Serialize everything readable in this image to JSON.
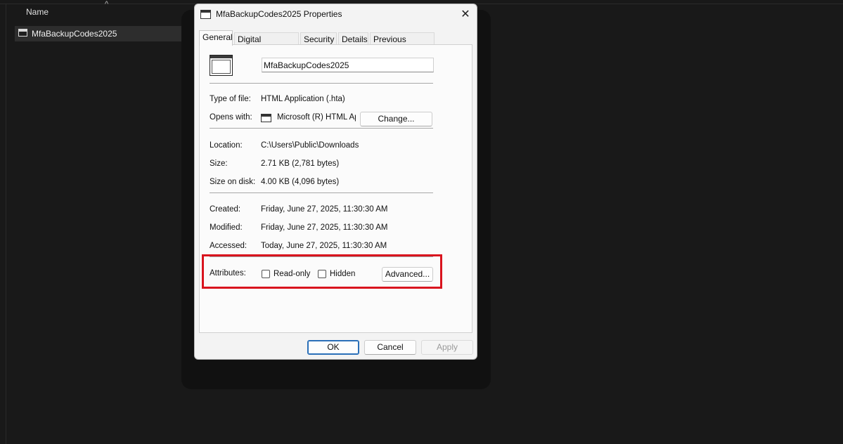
{
  "explorer": {
    "column_header": "Name",
    "sort_indicator": "^",
    "file_name": "MfaBackupCodes2025"
  },
  "dialog": {
    "title": "MfaBackupCodes2025 Properties",
    "close_glyph": "✕",
    "tabs": [
      "General",
      "Digital Signatures",
      "Security",
      "Details",
      "Previous Versions"
    ],
    "name_value": "MfaBackupCodes2025",
    "type_label": "Type of file:",
    "type_value": "HTML Application (.hta)",
    "opens_label": "Opens with:",
    "opens_value": "Microsoft (R) HTML Application",
    "change_button": "Change...",
    "location_label": "Location:",
    "location_value": "C:\\Users\\Public\\Downloads",
    "size_label": "Size:",
    "size_value": "2.71 KB (2,781 bytes)",
    "size_on_disk_label": "Size on disk:",
    "size_on_disk_value": "4.00 KB (4,096 bytes)",
    "created_label": "Created:",
    "created_value": "Friday, June 27, 2025, 11:30:30 AM",
    "modified_label": "Modified:",
    "modified_value": "Friday, June 27, 2025, 11:30:30 AM",
    "accessed_label": "Accessed:",
    "accessed_value": "Today, June 27, 2025, 11:30:30 AM",
    "attributes_label": "Attributes:",
    "readonly_label": "Read-only",
    "readonly_checked": false,
    "hidden_label": "Hidden",
    "hidden_checked": false,
    "advanced_button": "Advanced...",
    "ok_button": "OK",
    "cancel_button": "Cancel",
    "apply_button": "Apply"
  },
  "colors": {
    "highlight": "#d9141e",
    "default_button_border": "#2a6fb8"
  }
}
